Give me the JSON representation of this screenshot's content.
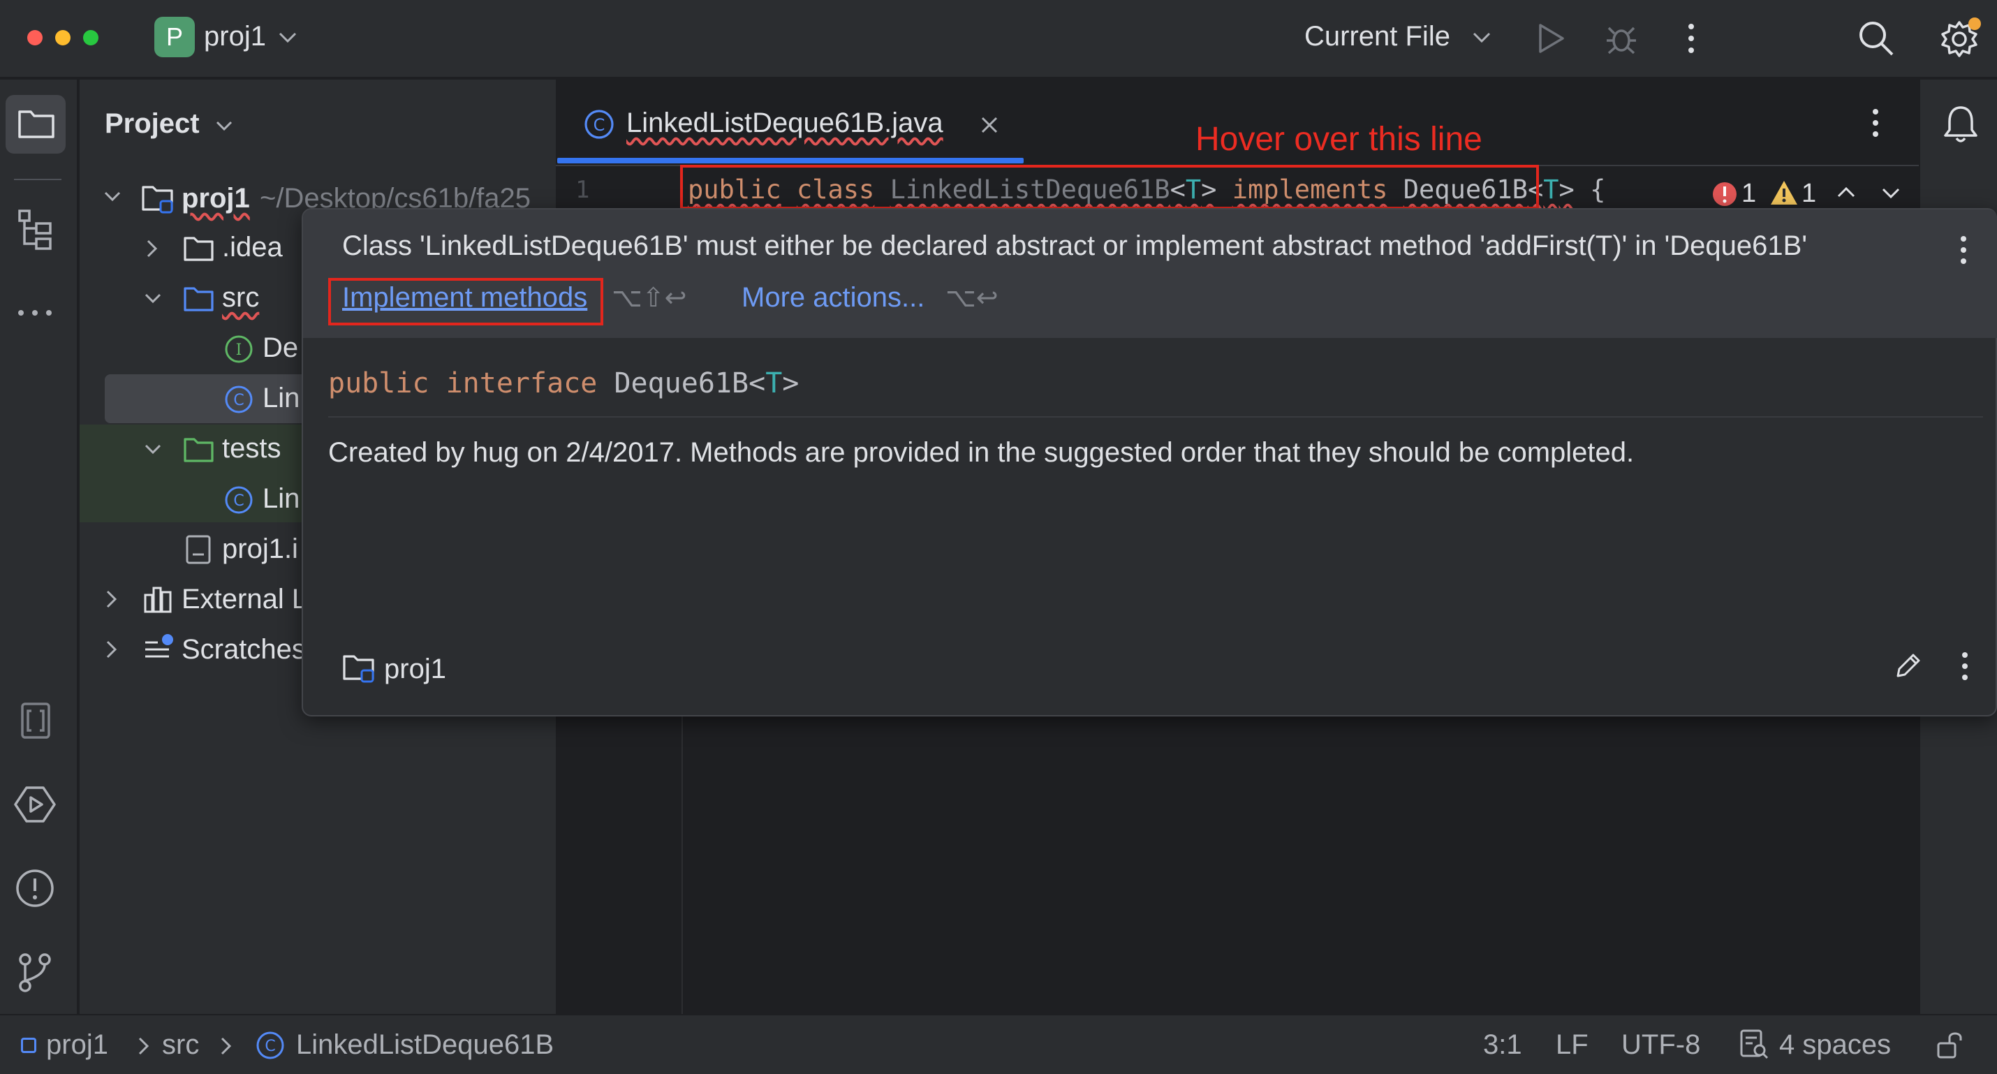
{
  "window": {
    "project_badge": "P",
    "project_name": "proj1",
    "run_config": "Current File"
  },
  "project_panel": {
    "title": "Project",
    "tree": [
      {
        "label": "proj1",
        "path": "~/Desktop/cs61b/fa25"
      },
      {
        "label": ".idea"
      },
      {
        "label": "src"
      },
      {
        "label": "De"
      },
      {
        "label": "Lin"
      },
      {
        "label": "tests"
      },
      {
        "label": "Lin"
      },
      {
        "label": "proj1.i"
      },
      {
        "label": "External L"
      },
      {
        "label": "Scratches"
      }
    ]
  },
  "editor": {
    "tab_label": "LinkedListDeque61B.java",
    "line_number": "1",
    "code": {
      "kw1": "public",
      "kw2": "class",
      "class_name": "LinkedListDeque61B",
      "lt": "<",
      "type_param": "T",
      "gt": ">",
      "kw3": "implements",
      "iface": "Deque61B",
      "brace": "{"
    },
    "error_count": "1",
    "warning_count": "1",
    "annotation": "Hover over this line"
  },
  "popup": {
    "message": "Class 'LinkedListDeque61B' must either be declared abstract or implement abstract method 'addFirst(T)' in 'Deque61B'",
    "implement_link": "Implement methods",
    "implement_shortcut": "⌥⇧↩",
    "more_actions": "More actions...",
    "more_shortcut": "⌥↩",
    "code_kw1": "public",
    "code_kw2": "interface",
    "code_name": "Deque61B",
    "code_type": "T",
    "doc": "Created by hug on 2/4/2017. Methods are provided in the suggested order that they should be completed.",
    "location": "proj1"
  },
  "statusbar": {
    "crumbs": [
      "proj1",
      "src",
      "LinkedListDeque61B"
    ],
    "position": "3:1",
    "line_sep": "LF",
    "encoding": "UTF-8",
    "indent": "4 spaces"
  },
  "colors": {
    "accent": "#3574f0",
    "error": "#e05555",
    "warning": "#f2c55c",
    "annotation_red": "#e3261d"
  }
}
